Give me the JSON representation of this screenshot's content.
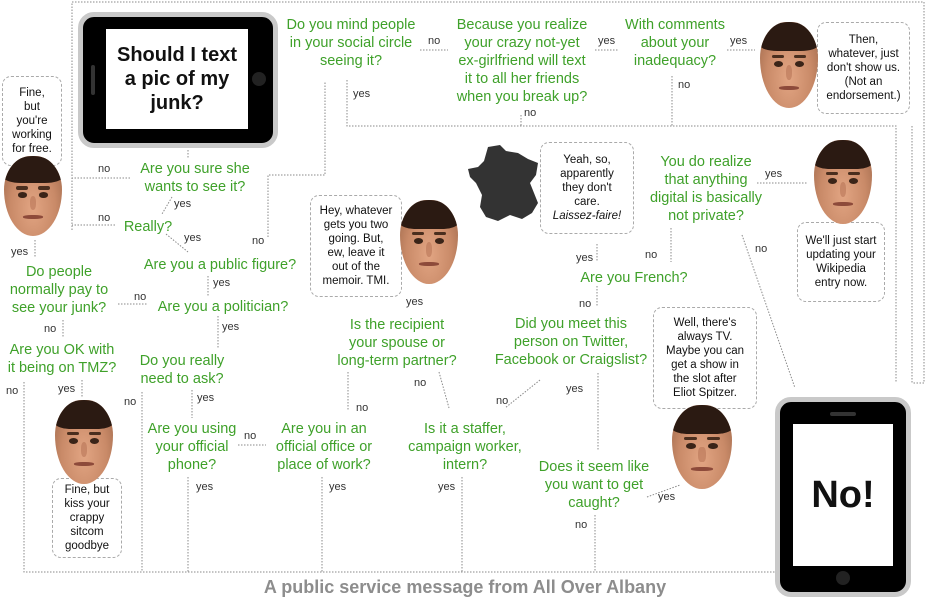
{
  "title": "Should I text a pic of my junk?",
  "colors": {
    "question": "#3fa12a",
    "label": "#333333",
    "footer": "#8d8d8d",
    "connector": "#8a8a8a"
  },
  "start": {
    "text": "Should I text a pic of my junk?",
    "icon": "phone-landscape-icon"
  },
  "end": {
    "text": "No!",
    "icon": "phone-portrait-icon"
  },
  "questions": {
    "mind_social": "Do you mind people\nin your social circle\nseeing it?",
    "crazy_gf": "Because you realize\nyour crazy not-yet\nex-girlfriend will text\nit to all her friends\nwhen you break up?",
    "comments": "With comments\nabout your\ninadequacy?",
    "sure_she": "Are you sure she\nwants to see it?",
    "really": "Really?",
    "public_figure": "Are you a public figure?",
    "politician": "Are you a politician?",
    "pay": "Do people\nnormally pay to\nsee your junk?",
    "tmz": "Are you OK with\nit being on TMZ?",
    "need_ask": "Do you really\nneed to ask?",
    "official_phone": "Are you using\nyour official\nphone?",
    "official_office": "Are you in an\nofficial office or\nplace of work?",
    "spouse": "Is the recipient\nyour spouse or\nlong-term partner?",
    "staffer": "Is it a staffer,\ncampaign worker,\nintern?",
    "met_online": "Did you meet this\nperson on Twitter,\nFacebook or Craigslist?",
    "caught": "Does it seem like\nyou want to get\ncaught?",
    "french": "Are you French?",
    "digital": "You do realize\nthat anything\ndigital is basically\nnot private?"
  },
  "bubbles": {
    "free": "Fine,\nbut\nyou're\nworking\nfor free.",
    "whatever": "Then,\nwhatever, just\ndon't show us.\n(Not an\nendorsement.)",
    "france": "Yeah, so,\napparently\nthey don't\ncare.",
    "france_italic": "Laissez-faire!",
    "memoir": "Hey, whatever\ngets you two\ngoing. But,\new, leave it\nout of the\nmemoir. TMI.",
    "wikipedia": "We'll just start\nupdating your\nWikipedia\nentry now.",
    "tv": "Well, there's\nalways TV.\nMaybe you can\nget a show in\nthe slot after\nEliot Spitzer.",
    "sitcom": "Fine, but\nkiss your\ncrappy\nsitcom\ngoodbye"
  },
  "labels": {
    "yes": "yes",
    "no": "no"
  },
  "footer": "A public service message from All Over Albany"
}
